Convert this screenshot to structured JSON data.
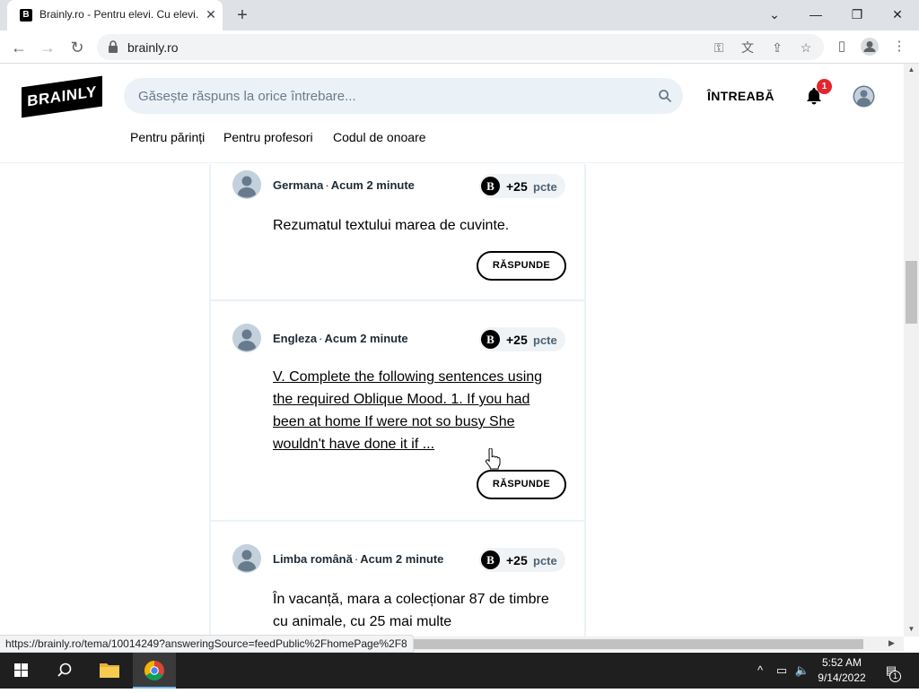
{
  "browser": {
    "tab_title": "Brainly.ro - Pentru elevi. Cu elevi.",
    "tab_favicon": "B",
    "url": "brainly.ro",
    "status_url": "https://brainly.ro/tema/10014249?answeringSource=feedPublic%2FhomePage%2F8"
  },
  "header": {
    "logo": "BRAINLY",
    "search_placeholder": "Găsește răspuns la orice întrebare...",
    "ask_label": "ÎNTREABĂ",
    "notification_count": "1",
    "subnav": [
      "Pentru părinți",
      "Pentru profesori",
      "Codul de onoare"
    ]
  },
  "feed": {
    "points_unit": "pcte",
    "answer_label": "RĂSPUNDE",
    "questions": [
      {
        "subject": "Germana",
        "time": "Acum 2 minute",
        "points": "+25",
        "text": "Rezumatul textului marea de cuvinte."
      },
      {
        "subject": "Engleza",
        "time": "Acum 2 minute",
        "points": "+25",
        "text": "V. Complete the following sentences using the required Oblique Mood. 1. If you had been at home If were not so busy She wouldn't have done it if ..."
      },
      {
        "subject": "Limba română",
        "time": "Acum 2 minute",
        "points": "+25",
        "text": "În vacanță, mara a colecționar 87 de timbre cu animale, cu 25 mai multe"
      }
    ]
  },
  "taskbar": {
    "time": "5:52 AM",
    "date": "9/14/2022",
    "notifications": "1"
  },
  "colors": {
    "brand": "#000000",
    "search_bg": "#ebf2f7",
    "badge": "#e4252b"
  }
}
